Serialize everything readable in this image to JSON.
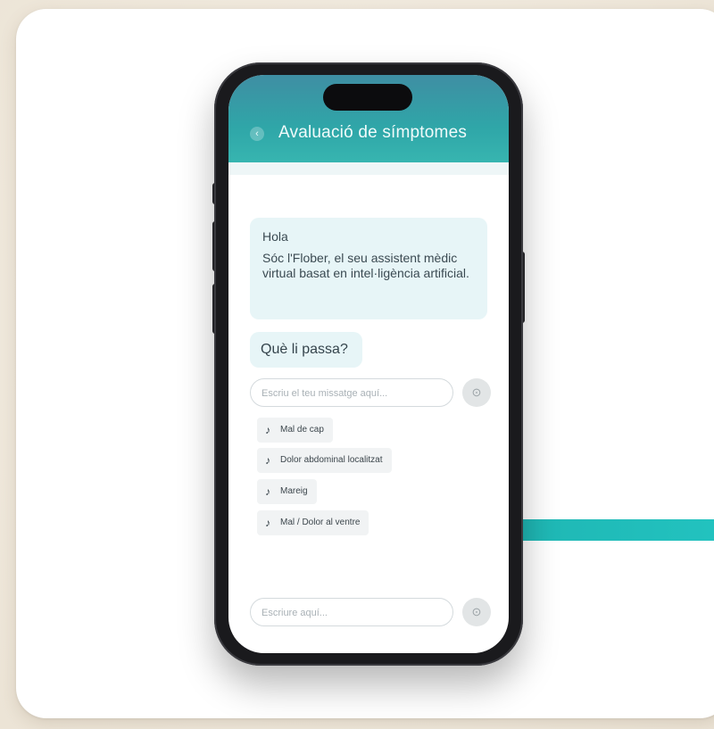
{
  "app": {
    "header_title": "Avaluació de símptomes",
    "back_icon": "back-icon"
  },
  "chat": {
    "greeting": "Hola",
    "intro": "Sóc l'Flober, el seu assistent mèdic virtual basat en intel·ligència artificial.",
    "question": "Què li passa?"
  },
  "composer_top": {
    "placeholder": "Escriu el teu missatge aquí...",
    "send_icon": "send-icon"
  },
  "suggestions": [
    {
      "icon": "music-note-icon",
      "label": "Mal de cap"
    },
    {
      "icon": "music-note-icon",
      "label": "Dolor abdominal localitzat"
    },
    {
      "icon": "music-note-icon",
      "label": "Mareig"
    },
    {
      "icon": "music-note-icon",
      "label": "Mal / Dolor al ventre"
    }
  ],
  "composer_bottom": {
    "placeholder": "Escriure aquí...",
    "send_icon": "send-icon"
  },
  "colors": {
    "header_top": "#3f8ea3",
    "header_bottom": "#37b5b0",
    "accent": "#1fb7b4",
    "bubble": "#e7f5f7"
  }
}
